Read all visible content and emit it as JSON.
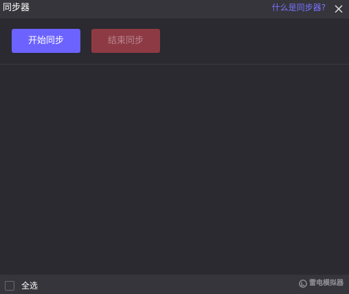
{
  "window": {
    "title": "同步器",
    "help_link": "什么是同步器?"
  },
  "toolbar": {
    "start_label": "开始同步",
    "stop_label": "结束同步"
  },
  "footer": {
    "select_all_label": "全选",
    "select_all_checked": false,
    "brand_text": "雷电模拟器"
  },
  "colors": {
    "accent": "#6c63ff",
    "stop_button": "#8e3a44",
    "link": "#7b74ff",
    "background": "#2a2a30",
    "bar": "#35353b"
  },
  "icons": {
    "close": "close-icon",
    "brand": "ld-logo-icon"
  }
}
